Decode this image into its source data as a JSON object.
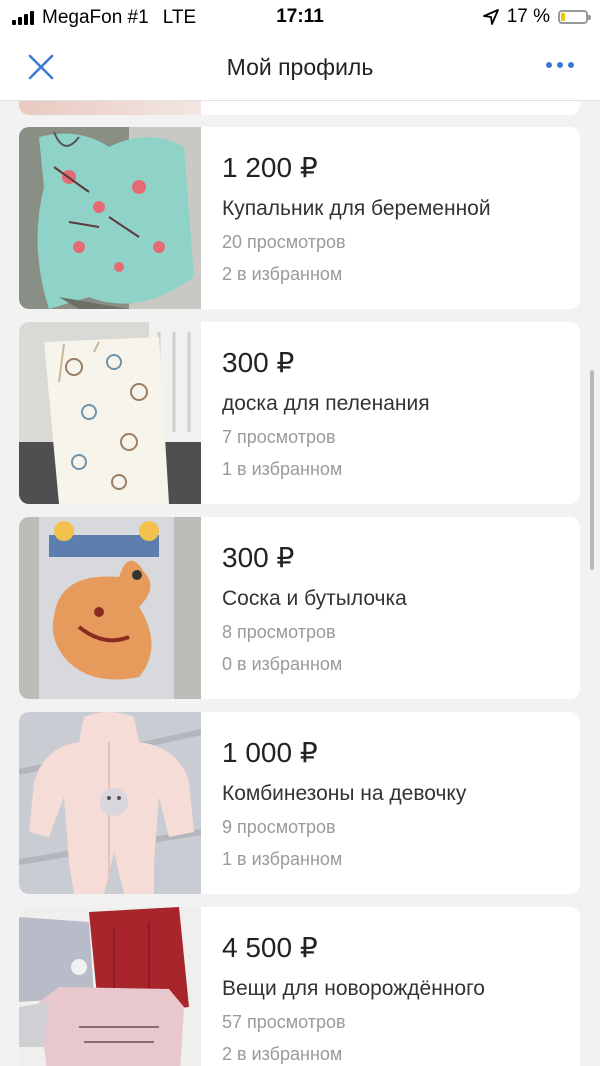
{
  "status": {
    "carrier": "MegaFon #1",
    "network": "LTE",
    "time": "17:11",
    "battery_text": "17 %",
    "battery_percent": 17
  },
  "nav": {
    "title": "Мой профиль",
    "close_icon": "close-icon",
    "more_icon": "more-icon",
    "accent": "#3a7bd5"
  },
  "listings": [
    {
      "price": "1 200 ₽",
      "title": "Купальник для беременной",
      "views": "20 просмотров",
      "favs": "2 в избранном"
    },
    {
      "price": "300 ₽",
      "title": "доска для пеленания",
      "views": "7 просмотров",
      "favs": "1 в избранном"
    },
    {
      "price": "300 ₽",
      "title": "Соска и бутылочка",
      "views": "8 просмотров",
      "favs": "0 в избранном"
    },
    {
      "price": "1 000 ₽",
      "title": "Комбинезоны на девочку",
      "views": "9 просмотров",
      "favs": "1 в избранном"
    },
    {
      "price": "4 500 ₽",
      "title": "Вещи для новорождённого",
      "views": "57 просмотров",
      "favs": "2 в избранном"
    }
  ]
}
